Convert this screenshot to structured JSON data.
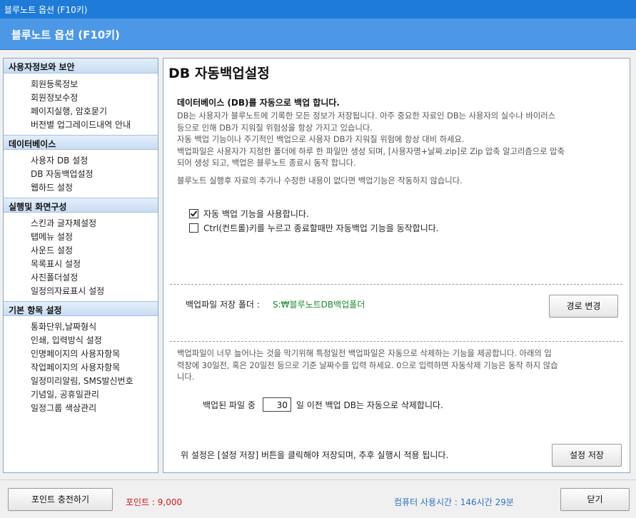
{
  "window": {
    "title": "블루노트 옵션 (F10키)"
  },
  "header": {
    "title": "블루노트 옵션 (F10키)"
  },
  "sidebar": {
    "sections": [
      {
        "title": "사용자정보와 보안",
        "items": [
          "회원등록정보",
          "회원정보수정",
          "페이지실행, 암호묻기",
          "버전별 업그레이드내역 안내"
        ]
      },
      {
        "title": "데이터베이스",
        "items": [
          "사용자 DB 설정",
          "DB 자동백업설정",
          "웹하드 설정"
        ]
      },
      {
        "title": "실행및 화면구성",
        "items": [
          "스킨과 글자체설정",
          "탭메뉴 설정",
          "사운드 설정",
          "목록표시 설정",
          "사진폴더설정",
          "일정의자료표시 설정"
        ]
      },
      {
        "title": "기본 항목 설정",
        "items": [
          "통화단위,날짜형식",
          "인쇄, 입력방식 설정",
          "인명페이지의 사용자항목",
          "작업페이지의 사용자항목",
          "일정미리알림, SMS발신번호",
          "기념일, 공휴일관리",
          "일정그룹 색상관리"
        ]
      }
    ]
  },
  "main": {
    "title": "DB 자동백업설정",
    "subtitle": "데이터베이스 (DB)를 자동으로 백업 합니다.",
    "desc_lines": [
      "DB는 사용자가 블루노트에 기록한 모든 정보가 저장됩니다. 아주 중요한 자료인 DB는 사용자의 실수나 바이러스",
      "등으로 인해 DB가 지워질 위험성을 항상 가지고 있습니다.",
      "자동 백업 기능이나 주기적인 백업으로 사용자 DB가 지워질 위험에 항상 대비 하세요.",
      "백업파일은 사용자가 지정한 폴더에 하루 한 파일만 생성 되며, [사용자명+날짜.zip]로 Zip 압축 알고리즘으로 압축",
      "되어 생성 되고, 백업은 블루노트 종료시 동작 합니다."
    ],
    "desc2": "블루노트 실행후 자료의 추가나 수정한 내용이 없다면 백업기능은 작동하지 않습니다.",
    "checkbox_auto_backup": {
      "label": "자동 백업 기능을 사용합니다.",
      "checked": true
    },
    "checkbox_ctrl_backup": {
      "label": "Ctrl(컨트롤)키를 누르고 종료할때만 자동백업 기능을 동작합니다.",
      "checked": false
    },
    "folder_label": "백업파일 저장 폴더 :",
    "folder_value": "S:₩블루노트DB백업폴더",
    "change_path_button": "경로 변경",
    "delete_desc_lines": [
      "백업파일이 너무 늘어나는 것을 막기위해 특정일전 백업파일은 자동으로 삭제하는 기능을 제공합니다. 아래의 입",
      "력창에 30일전, 혹은 20일전 등으로 기준 날짜수를 입력 하세요. 0으로 입력하면 자동삭제 기능은 동작 하지 않습",
      "니다."
    ],
    "delete_prefix": "백업된 파일 중",
    "delete_days": "30",
    "delete_suffix": "일 이전 백업 DB는 자동으로 삭제합니다.",
    "save_note": "위 설정은 [설정 저장] 버튼을 클릭해야 저장되며, 추후 실행시 적용 됩니다.",
    "save_button": "설정 저장"
  },
  "footer": {
    "charge_button": "포인트 충전하기",
    "points_text": "포인트 : 9,000",
    "usage_text": "컴퓨터 사용시간 : 146시간 29분",
    "close_button": "닫기"
  },
  "colors": {
    "titlebar": "#1f7bd8",
    "header": "#4c98e6",
    "points": "#d01818",
    "folder": "#1c8a2a",
    "usage": "#2b74c2"
  }
}
